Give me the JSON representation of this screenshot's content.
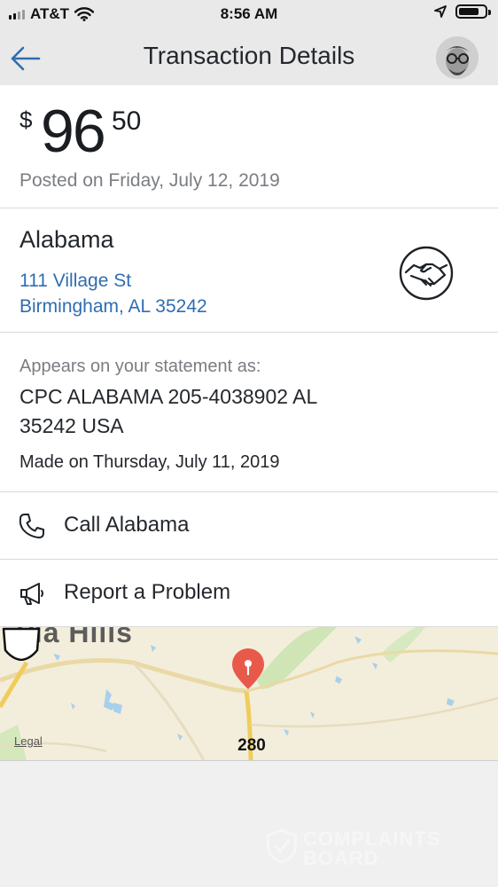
{
  "status_bar": {
    "carrier": "AT&T",
    "time": "8:56 AM",
    "icons": [
      "signal-icon",
      "wifi-icon",
      "location-arrow-icon",
      "battery-icon"
    ],
    "signal_bars": 4,
    "signal_active": 2,
    "battery_level": 0.8
  },
  "navbar": {
    "title": "Transaction Details",
    "back_icon": "arrow-left-icon"
  },
  "transaction": {
    "currency": "$",
    "amount_whole": "96",
    "amount_cents": "50",
    "posted": "Posted on Friday, July 12, 2019"
  },
  "merchant": {
    "name": "Alabama",
    "address_line1": "111 Village St",
    "address_line2": "Birmingham, AL 35242",
    "icon": "handshake-icon"
  },
  "statement": {
    "appears_label": "Appears on your statement as:",
    "description": "CPC ALABAMA 205-4038902 AL 35242 USA",
    "made_on": "Made on Thursday, July 11, 2019"
  },
  "actions": {
    "call_label": "Call Alabama",
    "report_label": "Report a Problem"
  },
  "map": {
    "place_label": "via Hills",
    "legal": "Legal",
    "route_shield": "280"
  },
  "watermark": {
    "line1": "COMPLAINTS",
    "line2": "BOARD"
  },
  "colors": {
    "accent": "#2f6db1",
    "pin": "#e8594a",
    "muted_text": "#7a7d82"
  }
}
